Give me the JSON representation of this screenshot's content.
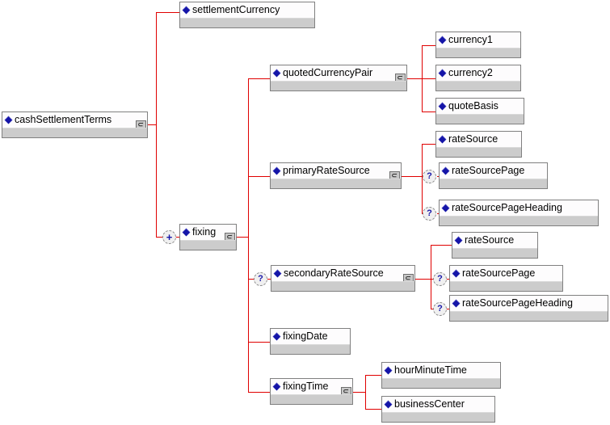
{
  "diagram": {
    "type": "xml-schema-tree",
    "title": "cashSettlementTerms",
    "accent_line_color": "#e00000",
    "element_marker_color": "#1515a8",
    "box_fill": "#fdfdfd",
    "box_type_strip": "#cccccc",
    "box_border": "#808080",
    "markers": {
      "optional": "?",
      "expand": "+"
    }
  },
  "nodes": {
    "cashSettlementTerms": {
      "label": "cashSettlementTerms",
      "has_sequence": true,
      "marker": null
    },
    "settlementCurrency": {
      "label": "settlementCurrency",
      "has_sequence": false,
      "marker": null
    },
    "fixing": {
      "label": "fixing",
      "has_sequence": true,
      "marker": "+"
    },
    "quotedCurrencyPair": {
      "label": "quotedCurrencyPair",
      "has_sequence": true,
      "marker": null
    },
    "currency1": {
      "label": "currency1",
      "has_sequence": false,
      "marker": null
    },
    "currency2": {
      "label": "currency2",
      "has_sequence": false,
      "marker": null
    },
    "quoteBasis": {
      "label": "quoteBasis",
      "has_sequence": false,
      "marker": null
    },
    "primaryRateSource": {
      "label": "primaryRateSource",
      "has_sequence": true,
      "marker": null
    },
    "p_rateSource": {
      "label": "rateSource",
      "has_sequence": false,
      "marker": null
    },
    "p_rateSourcePage": {
      "label": "rateSourcePage",
      "has_sequence": false,
      "marker": "?"
    },
    "p_rateSourcePageHeading": {
      "label": "rateSourcePageHeading",
      "has_sequence": false,
      "marker": "?"
    },
    "secondaryRateSource": {
      "label": "secondaryRateSource",
      "has_sequence": true,
      "marker": "?"
    },
    "s_rateSource": {
      "label": "rateSource",
      "has_sequence": false,
      "marker": null
    },
    "s_rateSourcePage": {
      "label": "rateSourcePage",
      "has_sequence": false,
      "marker": "?"
    },
    "s_rateSourcePageHeading": {
      "label": "rateSourcePageHeading",
      "has_sequence": false,
      "marker": "?"
    },
    "fixingDate": {
      "label": "fixingDate",
      "has_sequence": false,
      "marker": null
    },
    "fixingTime": {
      "label": "fixingTime",
      "has_sequence": true,
      "marker": null
    },
    "hourMinuteTime": {
      "label": "hourMinuteTime",
      "has_sequence": false,
      "marker": null
    },
    "businessCenter": {
      "label": "businessCenter",
      "has_sequence": false,
      "marker": null
    }
  }
}
